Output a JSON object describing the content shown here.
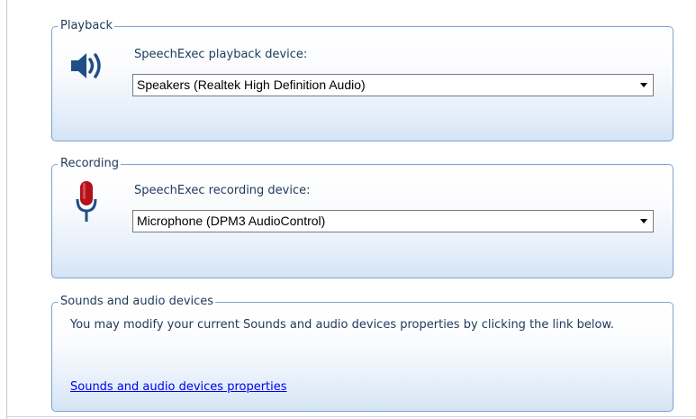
{
  "playback": {
    "title": "Playback",
    "label": "SpeechExec playback device:",
    "device": "Speakers (Realtek High Definition Audio)",
    "icon": "speaker-icon"
  },
  "recording": {
    "title": "Recording",
    "label": "SpeechExec recording device:",
    "device": "Microphone (DPM3 AudioControl)",
    "icon": "microphone-icon"
  },
  "sounds": {
    "title": "Sounds and audio devices",
    "description": "You may modify your current Sounds and audio devices properties by clicking the link below.",
    "link_text": "Sounds and audio devices properties"
  },
  "colors": {
    "group_border": "#7da2ce",
    "text": "#1e395b",
    "link": "#0000ee",
    "speaker": "#1f4f86",
    "mic_red": "#b3121c"
  }
}
